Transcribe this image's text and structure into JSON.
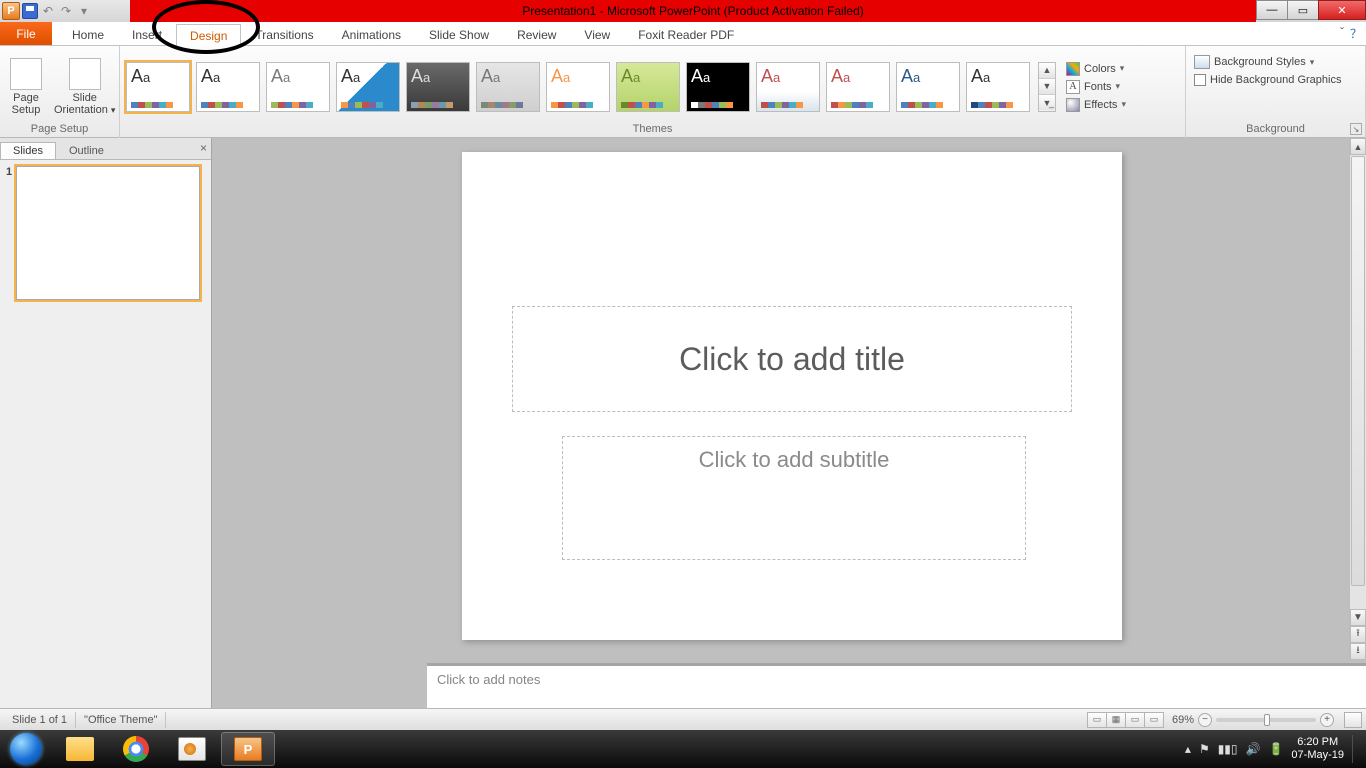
{
  "titlebar": {
    "title": "Presentation1  -  Microsoft PowerPoint (Product Activation Failed)"
  },
  "ribbonTabs": {
    "file": "File",
    "items": [
      "Home",
      "Insert",
      "Design",
      "Transitions",
      "Animations",
      "Slide Show",
      "Review",
      "View",
      "Foxit Reader PDF"
    ],
    "activeIndex": 2
  },
  "ribbon": {
    "pageSetup": {
      "btn1": "Page\nSetup",
      "btn2": "Slide\nOrientation",
      "label": "Page Setup"
    },
    "themes": {
      "label": "Themes",
      "colors": "Colors",
      "fonts": "Fonts",
      "effects": "Effects",
      "items": [
        {
          "aa": "#333",
          "bg": "#fff",
          "sw": [
            "#4f81bd",
            "#c0504d",
            "#9bbb59",
            "#8064a2",
            "#4bacc6",
            "#f79646"
          ]
        },
        {
          "aa": "#333",
          "bg": "#fff",
          "sw": [
            "#4f81bd",
            "#c0504d",
            "#9bbb59",
            "#8064a2",
            "#4bacc6",
            "#f79646"
          ]
        },
        {
          "aa": "#7a7a7a",
          "bg": "#fff",
          "sw": [
            "#9bbb59",
            "#c0504d",
            "#4f81bd",
            "#f79646",
            "#8064a2",
            "#4bacc6"
          ]
        },
        {
          "aa": "#333",
          "bg": "linear-gradient(135deg,#ffffff 45%,#2a8acb 45%)",
          "sw": [
            "#f79646",
            "#4f81bd",
            "#9bbb59",
            "#c0504d",
            "#8064a2",
            "#4bacc6"
          ]
        },
        {
          "aa": "#ddd",
          "bg": "linear-gradient(#6a6a6a,#3a3a3a)",
          "sw": [
            "#8aa0b0",
            "#b0885a",
            "#7a9a6a",
            "#9a7aa0",
            "#6a9aa8",
            "#c89a6a"
          ]
        },
        {
          "aa": "#777",
          "bg": "linear-gradient(#e6e6e6,#cfcfcf)",
          "sw": [
            "#7a8a78",
            "#a8866a",
            "#6a8aa0",
            "#a07a8a",
            "#8a9a6a",
            "#6a7a9a"
          ]
        },
        {
          "aa": "#f79646",
          "bg": "#fff",
          "sw": [
            "#f79646",
            "#c0504d",
            "#4f81bd",
            "#9bbb59",
            "#8064a2",
            "#4bacc6"
          ]
        },
        {
          "aa": "#6a8a2a",
          "bg": "linear-gradient(#d6e89a,#b4d46a)",
          "sw": [
            "#6a8a2a",
            "#c0504d",
            "#4f81bd",
            "#f79646",
            "#8064a2",
            "#4bacc6"
          ]
        },
        {
          "aa": "#fff",
          "bg": "#000",
          "sw": [
            "#ffffff",
            "#7a7a7a",
            "#c0504d",
            "#4f81bd",
            "#9bbb59",
            "#f79646"
          ]
        },
        {
          "aa": "#c0504d",
          "bg": "linear-gradient(#fff 60%,#d8e4ec)",
          "sw": [
            "#c0504d",
            "#4f81bd",
            "#9bbb59",
            "#8064a2",
            "#4bacc6",
            "#f79646"
          ]
        },
        {
          "aa": "#c0504d",
          "bg": "#fff",
          "sw": [
            "#c0504d",
            "#f79646",
            "#9bbb59",
            "#4f81bd",
            "#8064a2",
            "#4bacc6"
          ]
        },
        {
          "aa": "#2a5a8a",
          "bg": "#fff",
          "sw": [
            "#4f81bd",
            "#c0504d",
            "#9bbb59",
            "#8064a2",
            "#4bacc6",
            "#f79646"
          ]
        },
        {
          "aa": "#333",
          "bg": "#fff",
          "sw": [
            "#1f497d",
            "#4f81bd",
            "#c0504d",
            "#9bbb59",
            "#8064a2",
            "#f79646"
          ]
        }
      ]
    },
    "background": {
      "styles": "Background Styles",
      "hide": "Hide Background Graphics",
      "label": "Background"
    }
  },
  "slidePanel": {
    "tabs": [
      "Slides",
      "Outline"
    ],
    "activeIndex": 0,
    "slides": [
      {
        "num": "1"
      }
    ]
  },
  "slide": {
    "title_ph": "Click to add title",
    "subtitle_ph": "Click to add subtitle"
  },
  "notes": {
    "placeholder": "Click to add notes"
  },
  "statusbar": {
    "left1": "Slide 1 of 1",
    "left2": "\"Office Theme\"",
    "zoom": "69%"
  },
  "tray": {
    "time": "6:20 PM",
    "date": "07-May-19"
  }
}
